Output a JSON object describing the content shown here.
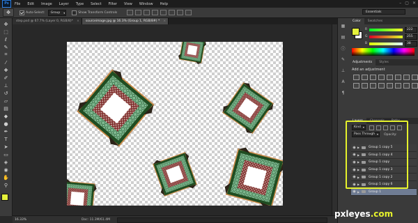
{
  "app": {
    "logo": "Ps"
  },
  "menu": [
    "File",
    "Edit",
    "Image",
    "Layer",
    "Type",
    "Select",
    "Filter",
    "View",
    "Window",
    "Help"
  ],
  "window_controls": [
    "–",
    "▢",
    "✕"
  ],
  "options_bar": {
    "auto_select_label": "Auto-Select:",
    "auto_select_value": "Group",
    "show_transform_label": "Show Transform Controls",
    "workspace": "Essentials"
  },
  "doc_tabs": [
    {
      "label": "step.psd @ 67.7% (Layer 0, RGB/8)*",
      "close": "×",
      "active": false
    },
    {
      "label": "sourceimage.jpg @ 16.3% (Group 1, RGB/8#) *",
      "close": "×",
      "active": true
    }
  ],
  "status_bar": {
    "zoom": "16.33%",
    "doc_info": "Doc: 11.3M/61.4M"
  },
  "color_panel": {
    "tabs": [
      "Color",
      "Swatches"
    ],
    "channels": [
      {
        "label": "R",
        "value": "222"
      },
      {
        "label": "G",
        "value": "255"
      },
      {
        "label": "B",
        "value": "38"
      }
    ],
    "foreground": "#e5f23b",
    "background": "#ffffff"
  },
  "adjustments_panel": {
    "tabs": [
      "Adjustments",
      "Styles"
    ],
    "title": "Add an adjustment"
  },
  "layers_panel": {
    "tabs": [
      "Layers",
      "Channels",
      "Paths"
    ],
    "filter_kind": "Kind",
    "blend_mode": "Pass Through",
    "opacity_label": "Opacity:",
    "layers": [
      {
        "name": "Group 1 copy 5",
        "selected": false
      },
      {
        "name": "Group 1 copy 4",
        "selected": false
      },
      {
        "name": "Group 1 copy",
        "selected": false
      },
      {
        "name": "Group 1 copy 3",
        "selected": false
      },
      {
        "name": "Group 1 copy 2",
        "selected": false
      },
      {
        "name": "Group 1 copy 6",
        "selected": false
      },
      {
        "name": "Group 1",
        "selected": true
      }
    ]
  },
  "watermark": {
    "text": "pxleyes",
    "suffix": ".com"
  },
  "colors": {
    "highlight": "#e6f22c",
    "selection": "#6f7c93",
    "frame_green": "#1f4d22",
    "tile_red": "#8a2b2b",
    "tile_green": "#7fb890"
  }
}
